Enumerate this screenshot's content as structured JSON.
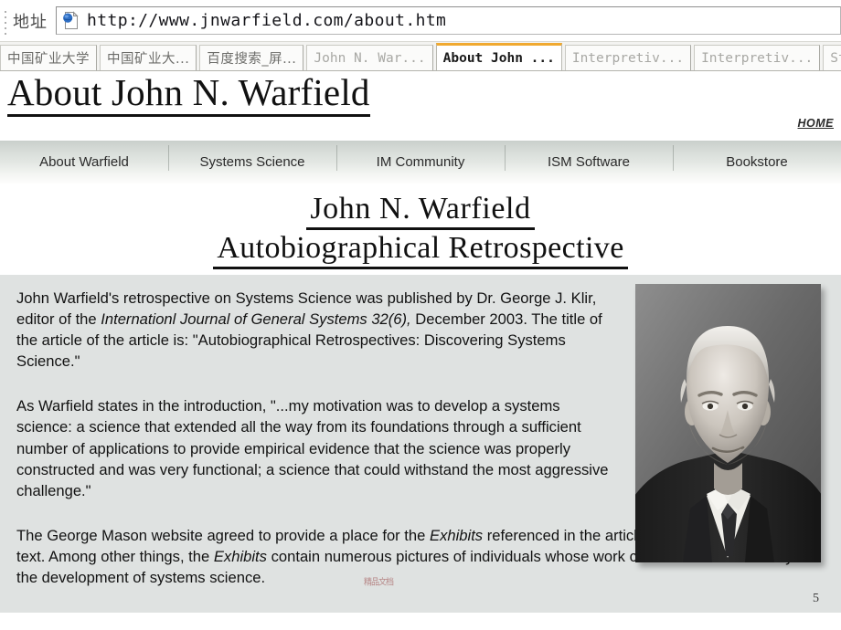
{
  "browser": {
    "address_label": "地址",
    "url": "http://www.jnwarfield.com/about.htm",
    "page_icon": "page-globe-icon",
    "tabs": [
      {
        "label": "中国矿业大学",
        "cjk": true,
        "active": false
      },
      {
        "label": "中国矿业大...",
        "cjk": true,
        "active": false
      },
      {
        "label": "百度搜索_屏...",
        "cjk": true,
        "active": false
      },
      {
        "label": "John N. War...",
        "cjk": false,
        "active": false
      },
      {
        "label": "About John ...",
        "cjk": false,
        "active": true
      },
      {
        "label": "Interpretiv...",
        "cjk": false,
        "active": false
      },
      {
        "label": "Interpretiv...",
        "cjk": false,
        "active": false
      },
      {
        "label": "Str",
        "cjk": false,
        "active": false
      }
    ]
  },
  "site": {
    "title": "About John N. Warfield",
    "home_link": "HOME",
    "nav": [
      "About Warfield",
      "Systems Science",
      "IM Community",
      "ISM Software",
      "Bookstore"
    ]
  },
  "headline": {
    "line1": "John N. Warfield",
    "line2": "Autobiographical Retrospective"
  },
  "paragraphs": {
    "p1_a": "John Warfield's retrospective on Systems Science was published by Dr. George J. Klir, editor of the ",
    "p1_italic": "Internationl Journal of General Systems 32(6),",
    "p1_b": " December 2003. The title of the article of the article is: \"Autobiographical Retrospectives: Discovering Systems Science.\"",
    "p2": "As Warfield states in the introduction, \"...my motivation was to develop a systems science: a science that extended all the way from its foundations through a sufficient number of applications to provide empirical evidence that the science was properly constructed and was very functional; a science that could withstand the most aggressive challenge.\"",
    "p3_a": "The George Mason website agreed to provide a place for the ",
    "p3_i1": "Exhibits",
    "p3_b": " referenced in the article as a supplement to the text.  Among other things, the ",
    "p3_i2": "Exhibits",
    "p3_c": " contain numerous pictures of individuals whose work contributed in some way to the development of systems science."
  },
  "portrait": {
    "alt": "Black and white portrait photograph of John N. Warfield in a dark suit and tie"
  },
  "overlay": {
    "watermark": "精品文档",
    "page_number": "5"
  },
  "colors": {
    "active_tab_accent": "#f0a930",
    "content_bg": "#dfe2e1",
    "nav_bg_top": "#c9cfcb",
    "text": "#121212"
  }
}
